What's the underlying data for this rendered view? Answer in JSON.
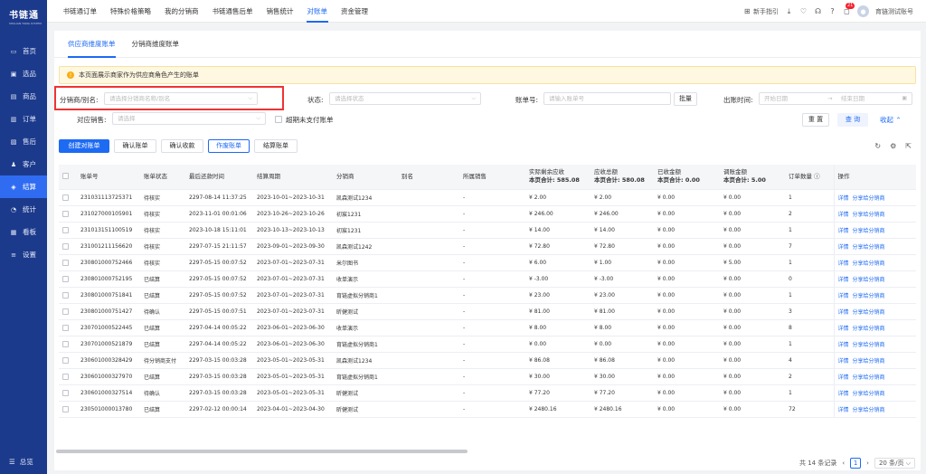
{
  "brand": {
    "name": "书链通",
    "sub": "SHULIAN TONG SYSTEM"
  },
  "sidebar": {
    "items": [
      {
        "label": "首页",
        "icon": "monitor-icon",
        "glyph": "▭"
      },
      {
        "label": "选品",
        "icon": "product-select-icon",
        "glyph": "▣"
      },
      {
        "label": "商品",
        "icon": "goods-icon",
        "glyph": "▤"
      },
      {
        "label": "订单",
        "icon": "order-icon",
        "glyph": "▥"
      },
      {
        "label": "售后",
        "icon": "after-sale-icon",
        "glyph": "▧"
      },
      {
        "label": "客户",
        "icon": "customer-icon",
        "glyph": "♟"
      },
      {
        "label": "结算",
        "icon": "settlement-icon",
        "glyph": "◈"
      },
      {
        "label": "统计",
        "icon": "stats-icon",
        "glyph": "◔"
      },
      {
        "label": "看板",
        "icon": "dashboard-icon",
        "glyph": "▦"
      },
      {
        "label": "设置",
        "icon": "settings-icon",
        "glyph": "≡"
      }
    ],
    "bottom": "总览"
  },
  "topnav": [
    "书链通订单",
    "特殊价格策略",
    "我的分销商",
    "书链通售后单",
    "销售统计",
    "对账单",
    "资金管理"
  ],
  "topright": {
    "guide": "新手指引",
    "badge": "21",
    "user": "育链测试账号"
  },
  "subtabs": [
    "供应商维度账单",
    "分销商维度账单"
  ],
  "notice": "本页面展示商家作为供应商角色产生的账单",
  "filters": {
    "distributor_label": "分销商/别名:",
    "distributor_ph": "请选择分销商名称/别名",
    "status_label": "状态:",
    "status_ph": "请选择状态",
    "bill_no_label": "账单号:",
    "bill_no_ph": "请输入账单号",
    "batch": "批量",
    "time_label": "出账时间:",
    "start_ph": "开始日期",
    "end_ph": "结束日期",
    "sales_label": "对应销售:",
    "sales_ph": "请选择",
    "expired_label": "超期未支付账单",
    "reset": "重 置",
    "query": "查 询",
    "collapse": "收起"
  },
  "actions": [
    "创建对账单",
    "确认账单",
    "确认收款",
    "作废账单",
    "结算账单"
  ],
  "table": {
    "headers": [
      "账单号",
      "账单状态",
      "最后还款时间",
      "结算周期",
      "分销商",
      "别名",
      "所属销售",
      "实际剩余应收",
      "应收总额",
      "已收金额",
      "调账金额",
      "订单数量",
      "操作"
    ],
    "sums": {
      "remaining": "本页合计: 585.08",
      "total": "本页合计: 580.08",
      "received": "本页合计: 0.00",
      "adjust": "本页合计: 5.00"
    },
    "ops": [
      "详情",
      "分享给分销商"
    ],
    "rows": [
      [
        "231031113725371",
        "待核实",
        "2297-08-14 11:37:25",
        "2023-10-01~2023-10-31",
        "凯森测试1234",
        "",
        "-",
        "¥ 2.00",
        "¥ 2.00",
        "¥ 0.00",
        "¥ 0.00",
        "1"
      ],
      [
        "231027000105901",
        "待核实",
        "2023-11-01 00:01:06",
        "2023-10-26~2023-10-26",
        "初宸1231",
        "",
        "-",
        "¥ 246.00",
        "¥ 246.00",
        "¥ 0.00",
        "¥ 0.00",
        "2"
      ],
      [
        "231013151100519",
        "待核实",
        "2023-10-18 15:11:01",
        "2023-10-13~2023-10-13",
        "初宸1231",
        "",
        "-",
        "¥ 14.00",
        "¥ 14.00",
        "¥ 0.00",
        "¥ 0.00",
        "1"
      ],
      [
        "231001211156620",
        "待核实",
        "2297-07-15 21:11:57",
        "2023-09-01~2023-09-30",
        "凯森测试1242",
        "",
        "-",
        "¥ 72.80",
        "¥ 72.80",
        "¥ 0.00",
        "¥ 0.00",
        "7"
      ],
      [
        "230801000752466",
        "待核实",
        "2297-05-15 00:07:52",
        "2023-07-01~2023-07-31",
        "米尔图书",
        "",
        "-",
        "¥ 6.00",
        "¥ 1.00",
        "¥ 0.00",
        "¥ 5.00",
        "1"
      ],
      [
        "230801000752195",
        "已结算",
        "2297-05-15 00:07:52",
        "2023-07-01~2023-07-31",
        "收单演示",
        "",
        "-",
        "¥ -3.00",
        "¥ -3.00",
        "¥ 0.00",
        "¥ 0.00",
        "0"
      ],
      [
        "230801000751841",
        "已结算",
        "2297-05-15 00:07:52",
        "2023-07-01~2023-07-31",
        "育链虚拟分销商1",
        "",
        "-",
        "¥ 23.00",
        "¥ 23.00",
        "¥ 0.00",
        "¥ 0.00",
        "1"
      ],
      [
        "230801000751427",
        "待确认",
        "2297-05-15 00:07:51",
        "2023-07-01~2023-07-31",
        "昕健测试",
        "",
        "-",
        "¥ 81.00",
        "¥ 81.00",
        "¥ 0.00",
        "¥ 0.00",
        "3"
      ],
      [
        "230701000522445",
        "已结算",
        "2297-04-14 00:05:22",
        "2023-06-01~2023-06-30",
        "收单演示",
        "",
        "-",
        "¥ 8.00",
        "¥ 8.00",
        "¥ 0.00",
        "¥ 0.00",
        "8"
      ],
      [
        "230701000521879",
        "已结算",
        "2297-04-14 00:05:22",
        "2023-06-01~2023-06-30",
        "育链虚拟分销商1",
        "",
        "-",
        "¥ 0.00",
        "¥ 0.00",
        "¥ 0.00",
        "¥ 0.00",
        "1"
      ],
      [
        "230601000328429",
        "待分销商支付",
        "2297-03-15 00:03:28",
        "2023-05-01~2023-05-31",
        "凯森测试1234",
        "",
        "-",
        "¥ 86.08",
        "¥ 86.08",
        "¥ 0.00",
        "¥ 0.00",
        "4"
      ],
      [
        "230601000327970",
        "已结算",
        "2297-03-15 00:03:28",
        "2023-05-01~2023-05-31",
        "育链虚拟分销商1",
        "",
        "-",
        "¥ 30.00",
        "¥ 30.00",
        "¥ 0.00",
        "¥ 0.00",
        "2"
      ],
      [
        "230601000327514",
        "待确认",
        "2297-03-15 00:03:28",
        "2023-05-01~2023-05-31",
        "昕健测试",
        "",
        "-",
        "¥ 77.20",
        "¥ 77.20",
        "¥ 0.00",
        "¥ 0.00",
        "1"
      ],
      [
        "230501000013780",
        "已结算",
        "2297-02-12 00:00:14",
        "2023-04-01~2023-04-30",
        "昕健测试",
        "",
        "-",
        "¥ 2480.16",
        "¥ 2480.16",
        "¥ 0.00",
        "¥ 0.00",
        "72"
      ]
    ]
  },
  "pager": {
    "total": "共 14 条记录",
    "page": "1",
    "size": "20 条/页"
  },
  "colors": {
    "sidebar": "#1c3a8c",
    "accent": "#1d6af3",
    "highlight": "#e33"
  }
}
